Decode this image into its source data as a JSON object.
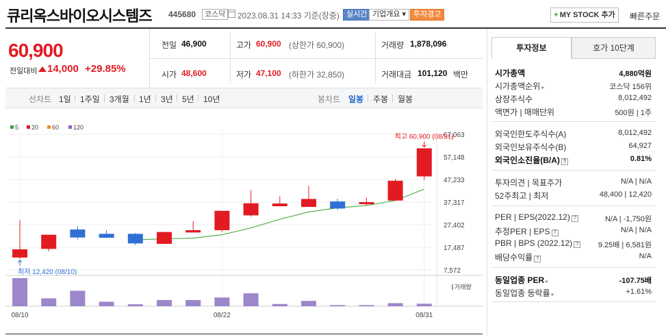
{
  "header": {
    "title": "큐리옥스바이오시스템즈",
    "code": "445680",
    "market": "코스닥",
    "timestamp": "2023.08.31 14:33  기준(장중)",
    "realtime": "실시간",
    "company_info": "기업개요 ▾",
    "warning": "투자경고",
    "mystock": "MY STOCK 추가",
    "fast_order": "빠른주문"
  },
  "price": {
    "current": "60,900",
    "change_label": "전일대비",
    "change": "14,000",
    "change_pct": "+29.85%"
  },
  "stats": {
    "prev_label": "전일",
    "prev": "46,900",
    "high_label": "고가",
    "high": "60,900",
    "upper_limit": "(상한가 60,900)",
    "volume_label": "거래량",
    "volume": "1,878,096",
    "open_label": "시가",
    "open": "48,600",
    "low_label": "저가",
    "low": "47,100",
    "lower_limit": "(하한가 32,850)",
    "amount_label": "거래대금",
    "amount": "101,120",
    "amount_unit": "백만"
  },
  "periods": {
    "line_label": "선차트",
    "items": [
      "1일",
      "1주일",
      "3개월",
      "1년",
      "3년",
      "5년",
      "10년"
    ],
    "candle_label": "봉차트",
    "candle_items": [
      "일봉",
      "주봉",
      "월봉"
    ]
  },
  "legend": [
    {
      "label": "5",
      "color": "#3aa636"
    },
    {
      "label": "20",
      "color": "#e21b23"
    },
    {
      "label": "60",
      "color": "#f08a24"
    },
    {
      "label": "120",
      "color": "#8e5ec2"
    }
  ],
  "chart_data": {
    "type": "candlestick",
    "y_ticks": [
      "67,063",
      "57,148",
      "47,233",
      "37,317",
      "27,402",
      "17,487",
      "7,572"
    ],
    "x_ticks": [
      "08/10",
      "08/22",
      "08/31"
    ],
    "max_annotation": "최고 60,900 (08/31)",
    "min_annotation": "최저 12,420 (08/10)",
    "volume_label": "거래량",
    "candles": [
      {
        "o": 13000,
        "c": 16600,
        "h": 29400,
        "l": 12420,
        "up": true
      },
      {
        "o": 16800,
        "c": 23000,
        "h": 23000,
        "l": 15800,
        "up": true
      },
      {
        "o": 25300,
        "c": 21800,
        "h": 26700,
        "l": 20900,
        "up": false
      },
      {
        "o": 23400,
        "c": 21700,
        "h": 25000,
        "l": 21500,
        "up": false
      },
      {
        "o": 23400,
        "c": 19200,
        "h": 23800,
        "l": 18400,
        "up": false
      },
      {
        "o": 19000,
        "c": 24200,
        "h": 24300,
        "l": 19000,
        "up": true
      },
      {
        "o": 24000,
        "c": 25000,
        "h": 28900,
        "l": 24000,
        "up": true
      },
      {
        "o": 25000,
        "c": 33500,
        "h": 33500,
        "l": 24200,
        "up": true
      },
      {
        "o": 31500,
        "c": 36800,
        "h": 42600,
        "l": 31000,
        "up": true
      },
      {
        "o": 35500,
        "c": 36700,
        "h": 39800,
        "l": 35500,
        "up": true
      },
      {
        "o": 35200,
        "c": 38700,
        "h": 44500,
        "l": 35200,
        "up": true
      },
      {
        "o": 37600,
        "c": 34500,
        "h": 38800,
        "l": 33800,
        "up": false
      },
      {
        "o": 36400,
        "c": 37300,
        "h": 39300,
        "l": 35700,
        "up": true
      },
      {
        "o": 38000,
        "c": 46700,
        "h": 47500,
        "l": 38000,
        "up": true
      },
      {
        "o": 48600,
        "c": 60900,
        "h": 60900,
        "l": 47100,
        "up": true
      }
    ],
    "ma5": [
      null,
      null,
      null,
      null,
      20800,
      21200,
      21500,
      23000,
      26000,
      29800,
      33000,
      34800,
      35800,
      38000,
      43000
    ],
    "volume": [
      100,
      28,
      55,
      16,
      7,
      22,
      22,
      31,
      46,
      8,
      19,
      4,
      4,
      11,
      9
    ],
    "ylim": [
      7572,
      67063
    ]
  },
  "right_panel": {
    "tab_active": "투자정보",
    "tab_other": "호가 10단계",
    "market_cap_label": "시가총액",
    "market_cap": "4,880억원",
    "cap_rank_label": "시가총액순위",
    "cap_rank": "코스닥 156위",
    "shares_label": "상장주식수",
    "shares": "8,012,492",
    "face_label": "액면가 | 매매단위",
    "face": "500원 | 1주",
    "foreign_limit_label": "외국인한도주식수(A)",
    "foreign_limit": "8,012,492",
    "foreign_hold_label": "외국인보유주식수(B)",
    "foreign_hold": "64,927",
    "foreign_rate_label": "외국인소진율(B/A)",
    "foreign_rate": "0.81%",
    "opinion_label": "투자의견 | 목표주가",
    "opinion": "N/A | N/A",
    "week52_label": "52주최고 | 최저",
    "week52": "48,400 | 12,420",
    "per_label": "PER | EPS(2022.12)",
    "per": "N/A | -1,750원",
    "est_per_label": "추정PER | EPS",
    "est_per": "N/A | N/A",
    "pbr_label": "PBR | BPS (2022.12)",
    "pbr": "9.25배 | 6,581원",
    "div_label": "배당수익률",
    "div": "N/A",
    "ind_per_label": "동일업종 PER",
    "ind_per": "-107.75배",
    "ind_chg_label": "동일업종 등락률",
    "ind_chg": "+1.61%"
  }
}
